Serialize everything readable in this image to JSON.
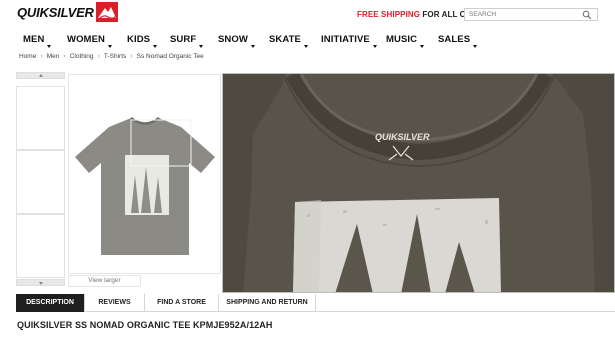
{
  "header": {
    "logo_text": "QUIKSILVER",
    "logo_icon": "quiksilver-mountain-wave-logo",
    "shipping_promo_highlight": "FREE SHIPPING",
    "shipping_promo_rest": " FOR ALL ORDERS",
    "search_placeholder": "SEARCH",
    "search_icon": "magnifier-icon",
    "brand_color": "#d8202a"
  },
  "nav": {
    "items": [
      {
        "label": "MEN"
      },
      {
        "label": "WOMEN"
      },
      {
        "label": "KIDS"
      },
      {
        "label": "SURF"
      },
      {
        "label": "SNOW"
      },
      {
        "label": "SKATE"
      },
      {
        "label": "INITIATIVE"
      },
      {
        "label": "MUSIC"
      },
      {
        "label": "SALES"
      }
    ]
  },
  "breadcrumb": [
    "Home",
    "Men",
    "Clothing",
    "T-Shirts",
    "Ss Nomad Organic Tee"
  ],
  "gallery": {
    "view_larger": "View larger"
  },
  "tabs": [
    {
      "label": "DESCRIPTION",
      "active": true
    },
    {
      "label": "REVIEWS",
      "active": false
    },
    {
      "label": "FIND A STORE",
      "active": false
    },
    {
      "label": "SHIPPING AND RETURN",
      "active": false
    }
  ],
  "product": {
    "title": "QUIKSILVER SS NOMAD ORGANIC TEE KPMJE952A/12AH"
  }
}
